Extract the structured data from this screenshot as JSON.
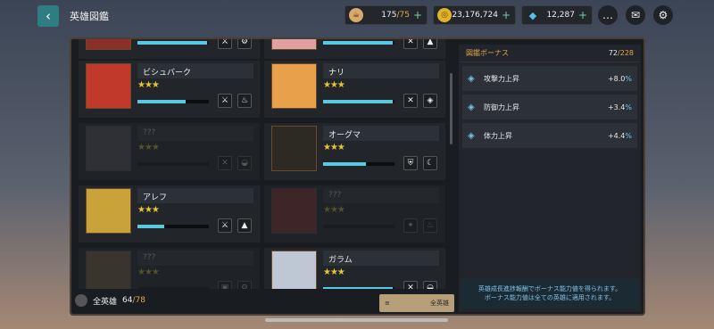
{
  "header": {
    "back_icon": "back-arrow-icon",
    "title": "英雄図鑑"
  },
  "resources": [
    {
      "icon": "coffee-cup-icon",
      "value": "175",
      "max": "/75",
      "color": "#d7a96a"
    },
    {
      "icon": "gold-coin-icon",
      "value": "23,176,724",
      "max": "",
      "color": "#e1b32c"
    },
    {
      "icon": "gem-icon",
      "value": "12,287",
      "max": "",
      "color": "#4fc3f0"
    }
  ],
  "buttons": {
    "chat_icon": "chat-icon",
    "mail_icon": "mail-icon",
    "settings_icon": "gear-icon"
  },
  "cards": [
    {
      "name": "",
      "stars": "★★★",
      "locked": false,
      "progress": 0.98,
      "tags": [
        "sword-icon",
        "gear-icon"
      ],
      "partial": true
    },
    {
      "name": "",
      "stars": "★★★",
      "locked": false,
      "progress": 0.98,
      "tags": [
        "crossed-icon",
        "mountain-icon"
      ],
      "partial": true
    },
    {
      "name": "ビシュバーク",
      "stars": "★★★",
      "locked": false,
      "progress": 0.68,
      "tags": [
        "sword-icon",
        "fire-icon"
      ]
    },
    {
      "name": "ナリ",
      "stars": "★★★",
      "locked": false,
      "progress": 0.98,
      "tags": [
        "crossed-icon",
        "diamond-icon"
      ]
    },
    {
      "name": "???",
      "stars": "★★★",
      "locked": true,
      "progress": 0,
      "tags": [
        "crossed-icon",
        "water-icon"
      ]
    },
    {
      "name": "オーグマ",
      "stars": "★★★",
      "locked": false,
      "progress": 0.6,
      "tags": [
        "shield-icon",
        "moon-icon"
      ]
    },
    {
      "name": "アレフ",
      "stars": "★★★",
      "locked": false,
      "progress": 0.38,
      "tags": [
        "sword-icon",
        "mountain-icon"
      ]
    },
    {
      "name": "???",
      "stars": "★★★",
      "locked": true,
      "progress": 0,
      "tags": [
        "fan-icon",
        "fire-icon"
      ]
    },
    {
      "name": "???",
      "stars": "★★★",
      "locked": true,
      "progress": 0,
      "tags": [
        "box-icon",
        "gear-icon"
      ]
    },
    {
      "name": "ガラム",
      "stars": "★★★",
      "locked": false,
      "progress": 0.98,
      "tags": [
        "crossed-icon",
        "water-icon"
      ]
    }
  ],
  "footer": {
    "icon": "hero-icon",
    "label": "全英雄",
    "count": "64",
    "total": "/78"
  },
  "filter": {
    "icon": "menu-icon",
    "label": "全英雄"
  },
  "bonus": {
    "title": "図鑑ボーナス",
    "current": "72",
    "total": "/228",
    "rows": [
      {
        "label": "攻撃力上昇",
        "value": "+8.0",
        "pct": "%"
      },
      {
        "label": "防御力上昇",
        "value": "+3.4",
        "pct": "%"
      },
      {
        "label": "体力上昇",
        "value": "+4.4",
        "pct": "%"
      }
    ],
    "note1": "英雄成長進捗報酬でボーナス能力値を得られます。",
    "note2": "ボーナス能力値は全ての英雄に適用されます。"
  }
}
